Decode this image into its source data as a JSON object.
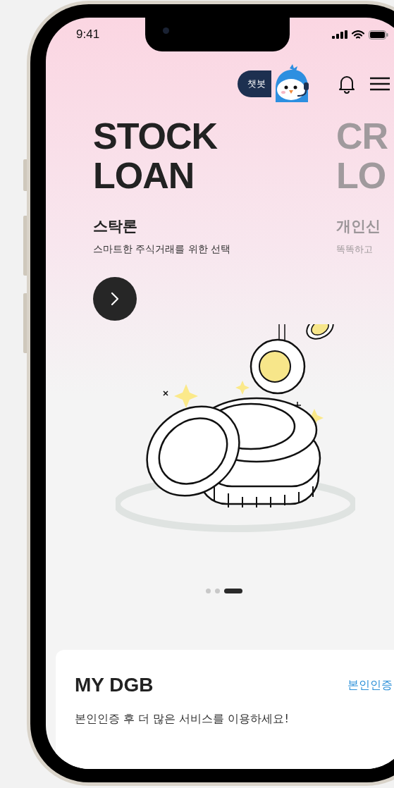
{
  "status_bar": {
    "time": "9:41"
  },
  "header": {
    "chatbot_label": "챗봇"
  },
  "slides": [
    {
      "title_lines": [
        "STOCK",
        "LOAN"
      ],
      "name": "스탁론",
      "description": "스마트한 주식거래를 위한 선택",
      "active": true
    },
    {
      "title_lines": [
        "CR",
        "LO"
      ],
      "name": "개인신",
      "description": "똑똑하고",
      "active": false
    }
  ],
  "pager": [
    {
      "selected": false
    },
    {
      "selected": false
    },
    {
      "selected": true
    }
  ],
  "my_card": {
    "title": "MY DGB",
    "link": "본인인증",
    "message": "본인인증 후 더 많은 서비스를 이용하세요!"
  }
}
